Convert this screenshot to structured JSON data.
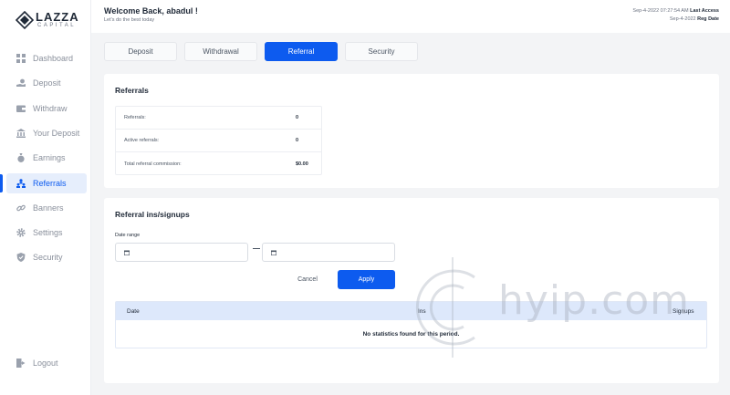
{
  "brand": {
    "name": "LAZZA",
    "subtitle": "CAPITAL"
  },
  "sidebar": {
    "items": [
      {
        "label": "Dashboard",
        "icon": "grid-icon"
      },
      {
        "label": "Deposit",
        "icon": "hand-coin-icon"
      },
      {
        "label": "Withdraw",
        "icon": "wallet-icon"
      },
      {
        "label": "Your Deposit",
        "icon": "bank-icon"
      },
      {
        "label": "Earnings",
        "icon": "money-bag-icon"
      },
      {
        "label": "Referrals",
        "icon": "people-icon",
        "active": true
      },
      {
        "label": "Banners",
        "icon": "link-icon"
      },
      {
        "label": "Settings",
        "icon": "gear-icon"
      },
      {
        "label": "Security",
        "icon": "shield-icon"
      }
    ],
    "logout": "Logout"
  },
  "header": {
    "welcome": "Welcome Back, abadul !",
    "subtitle": "Let's do the best today",
    "last_access_value": "Sep-4-2022 07:27:54 AM",
    "last_access_label": "Last Access",
    "reg_date_value": "Sep-4-2022",
    "reg_date_label": "Reg Date"
  },
  "tabs": [
    {
      "label": "Deposit"
    },
    {
      "label": "Withdrawal"
    },
    {
      "label": "Referral",
      "active": true
    },
    {
      "label": "Security"
    }
  ],
  "referrals": {
    "title": "Referrals",
    "rows": [
      {
        "label": "Referrals:",
        "value": "0"
      },
      {
        "label": "Active referrals:",
        "value": "0"
      },
      {
        "label": "Total referral commission:",
        "value": "$0.00"
      }
    ]
  },
  "signups": {
    "title": "Referral ins/signups",
    "date_range_label": "Date range",
    "from_value": "",
    "to_value": "",
    "cancel_label": "Cancel",
    "apply_label": "Apply",
    "columns": [
      "Date",
      "Ins",
      "Signups"
    ],
    "empty_message": "No statistics found for this period."
  },
  "watermark": "hyip.com",
  "colors": {
    "accent": "#0d5bef",
    "table_header": "#dde8fb",
    "sidebar_active_bg": "#e6eefc"
  }
}
